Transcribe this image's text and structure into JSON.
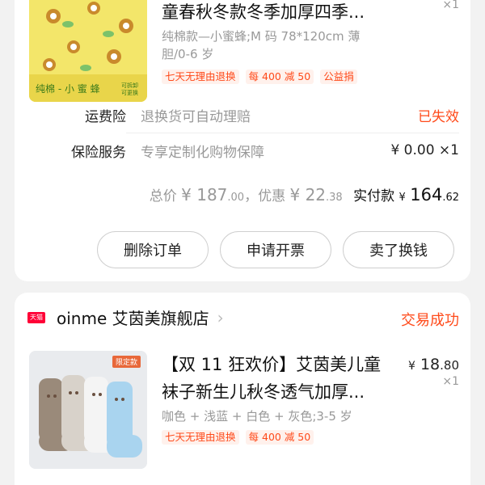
{
  "orders": [
    {
      "product": {
        "title_line1": "童春秋冬款冬季加厚四季...",
        "spec_line1": "纯棉款—小蜜蜂;M 码 78*120cm 薄",
        "spec_line2": "胆/0-6 岁",
        "tags": [
          "七天无理由退换",
          "每 400 减 50",
          "公益捐"
        ],
        "qty": "×1",
        "thumb_caption": "纯棉 - 小 蜜 蜂",
        "thumb_badge": "可拆卸 可更换"
      },
      "shipping_insurance": {
        "label": "运费险",
        "desc": "退换货可自动理赔",
        "value": "已失效"
      },
      "insurance_service": {
        "label": "保险服务",
        "desc": "专享定制化购物保障",
        "value": "¥ 0.00 ×1"
      },
      "summary": {
        "total_label": "总价",
        "total_int": "¥ 187",
        "total_dec": ".00",
        "sep": "，",
        "discount_label": "优惠",
        "discount_int": "¥ 22",
        "discount_dec": ".38",
        "paid_label": "实付款",
        "paid_sym": "¥",
        "paid_int": "164",
        "paid_dec": ".62"
      },
      "buttons": [
        "删除订单",
        "申请开票",
        "卖了换钱"
      ]
    },
    {
      "shop": {
        "logo_text": "天猫",
        "name": "oinme 艾茵美旗舰店",
        "chevron": "›",
        "status": "交易成功"
      },
      "product": {
        "title_line1": "【双 11 狂欢价】艾茵美儿童",
        "title_line2": "袜子新生儿秋冬透气加厚...",
        "spec_line1": "咖色 + 浅蓝 + 白色 + 灰色;3-5 岁",
        "tags": [
          "七天无理由退换",
          "每 400 减 50"
        ],
        "price_sym": "¥",
        "price_int": "18",
        "price_dec": ".80",
        "qty": "×1",
        "thumb_badge": "限定款"
      }
    }
  ],
  "colors": {
    "accent": "#ff4a1a",
    "tag_bg": "#fff1ec",
    "page_bg": "#f2f2f2",
    "tmall_red": "#ff0036"
  }
}
